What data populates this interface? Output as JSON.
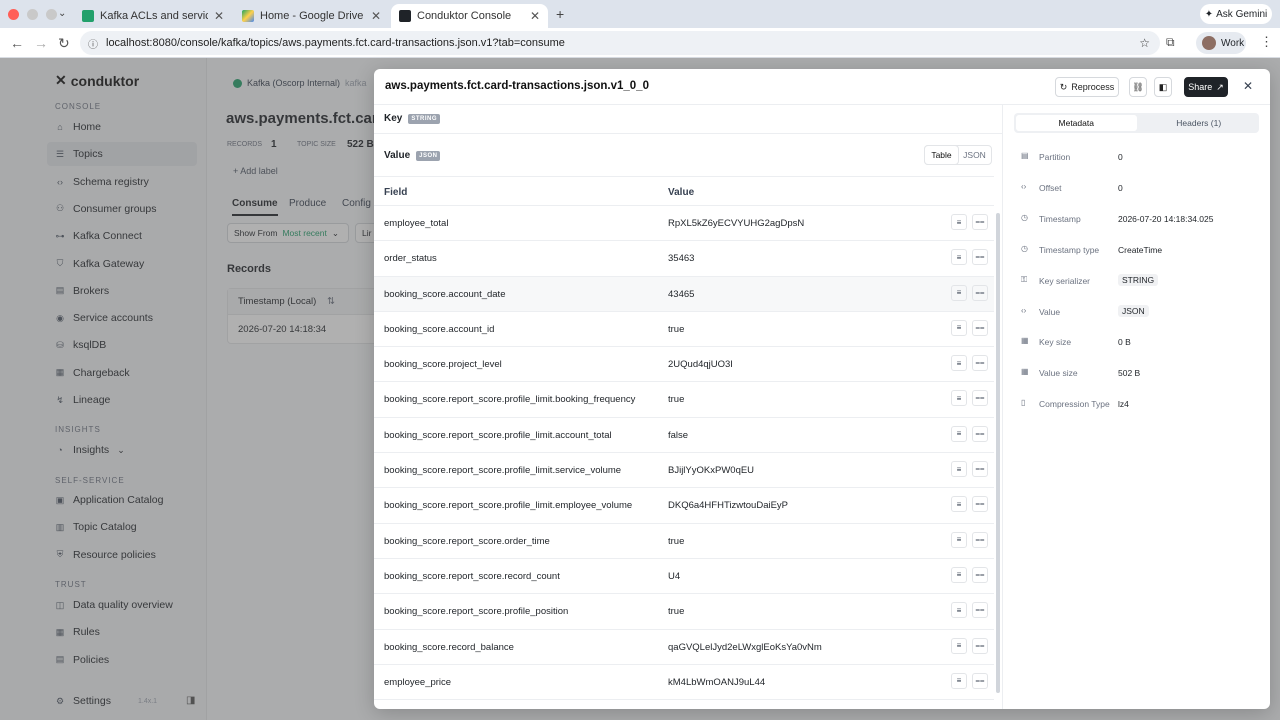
{
  "browser": {
    "tabs": [
      {
        "title": "Kafka ACLs and service acco",
        "active": false
      },
      {
        "title": "Home - Google Drive",
        "active": false
      },
      {
        "title": "Conduktor Console",
        "active": true
      }
    ],
    "new_tab": "+",
    "gemini": "Ask Gemini",
    "url": "localhost:8080/console/kafka/topics/aws.payments.fct.card-transactions.json.v1?tab=consume",
    "profile": "Work"
  },
  "sidebar": {
    "logo": "conduktor",
    "sections": {
      "console": "CONSOLE",
      "insights": "INSIGHTS",
      "self_service": "SELF-SERVICE",
      "trust": "TRUST"
    },
    "console_items": [
      {
        "label": "Home",
        "icon": "home-icon"
      },
      {
        "label": "Topics",
        "icon": "topics-icon"
      },
      {
        "label": "Schema registry",
        "icon": "code-icon"
      },
      {
        "label": "Consumer groups",
        "icon": "groups-icon"
      },
      {
        "label": "Kafka Connect",
        "icon": "connect-icon"
      },
      {
        "label": "Kafka Gateway",
        "icon": "gateway-icon"
      },
      {
        "label": "Brokers",
        "icon": "brokers-icon"
      },
      {
        "label": "Service accounts",
        "icon": "account-icon"
      },
      {
        "label": "ksqlDB",
        "icon": "db-icon"
      },
      {
        "label": "Chargeback",
        "icon": "chart-icon"
      },
      {
        "label": "Lineage",
        "icon": "lineage-icon"
      }
    ],
    "insights_items": [
      {
        "label": "Insights",
        "icon": "insights-icon"
      }
    ],
    "self_service_items": [
      {
        "label": "Application Catalog",
        "icon": "catalog-icon"
      },
      {
        "label": "Topic Catalog",
        "icon": "book-icon"
      },
      {
        "label": "Resource policies",
        "icon": "policy-icon"
      }
    ],
    "trust_items": [
      {
        "label": "Data quality overview",
        "icon": "quality-icon"
      },
      {
        "label": "Rules",
        "icon": "rules-icon"
      },
      {
        "label": "Policies",
        "icon": "policies-icon"
      }
    ],
    "settings": "Settings",
    "version": "1.4x.1"
  },
  "page": {
    "cluster": "Kafka (Oscorp Internal)",
    "cluster_tag": "kafka",
    "title": "aws.payments.fct.card",
    "records_label": "RECORDS",
    "records_value": "1",
    "topic_size_label": "TOPIC SIZE",
    "topic_size_value": "522 B",
    "add_label": "+ Add label",
    "tabs": [
      "Consume",
      "Produce",
      "Config"
    ],
    "show_from_label": "Show From",
    "show_from_value": "Most recent",
    "limit_short": "Lir",
    "records_heading": "Records",
    "table_header": "Timestamp (Local)",
    "record_ts": "2026-07-20 14:18:34"
  },
  "drawer": {
    "title": "aws.payments.fct.card-transactions.json.v1_0_0",
    "reprocess": "Reprocess",
    "share": "Share",
    "key_label": "Key",
    "key_badge": "STRING",
    "value_label": "Value",
    "value_badge": "JSON",
    "view_table": "Table",
    "view_json": "JSON",
    "col_field": "Field",
    "col_value": "Value",
    "rows": [
      {
        "field": "employee_total",
        "value": "RpXL5kZ6yECVYUHG2agDpsN"
      },
      {
        "field": "order_status",
        "value": "35463"
      },
      {
        "field": "booking_score.account_date",
        "value": "43465"
      },
      {
        "field": "booking_score.account_id",
        "value": "true"
      },
      {
        "field": "booking_score.project_level",
        "value": "2UQud4qjUO3I"
      },
      {
        "field": "booking_score.report_score.profile_limit.booking_frequency",
        "value": "true"
      },
      {
        "field": "booking_score.report_score.profile_limit.account_total",
        "value": "false"
      },
      {
        "field": "booking_score.report_score.profile_limit.service_volume",
        "value": "BJijlYyOKxPW0qEU"
      },
      {
        "field": "booking_score.report_score.profile_limit.employee_volume",
        "value": "DKQ6a4HFHTizwtouDaiEyP"
      },
      {
        "field": "booking_score.report_score.order_time",
        "value": "true"
      },
      {
        "field": "booking_score.report_score.record_count",
        "value": "U4"
      },
      {
        "field": "booking_score.report_score.profile_position",
        "value": "true"
      },
      {
        "field": "booking_score.record_balance",
        "value": "qaGVQLelJyd2eLWxglEoKsYa0vNm"
      },
      {
        "field": "employee_price",
        "value": "kM4LbWmOANJ9uL44"
      }
    ],
    "metadata_tab": "Metadata",
    "headers_tab": "Headers (1)",
    "metadata": [
      {
        "label": "Partition",
        "value": "0",
        "icon": "partition-icon"
      },
      {
        "label": "Offset",
        "value": "0",
        "icon": "offset-icon"
      },
      {
        "label": "Timestamp",
        "value": "2026-07-20 14:18:34.025",
        "icon": "clock-icon"
      },
      {
        "label": "Timestamp type",
        "value": "CreateTime",
        "icon": "clock-icon"
      },
      {
        "label": "Key serializer",
        "value": "STRING",
        "icon": "key-icon"
      },
      {
        "label": "Value",
        "value": "JSON",
        "icon": "code-icon"
      },
      {
        "label": "Key size",
        "value": "0 B",
        "icon": "size-icon"
      },
      {
        "label": "Value size",
        "value": "502 B",
        "icon": "size-icon"
      },
      {
        "label": "Compression Type",
        "value": "lz4",
        "icon": "compress-icon"
      }
    ]
  },
  "colors": {
    "accent": "#1f2328",
    "success": "#22a06b",
    "overlay": "rgba(80,80,80,0.45)"
  }
}
